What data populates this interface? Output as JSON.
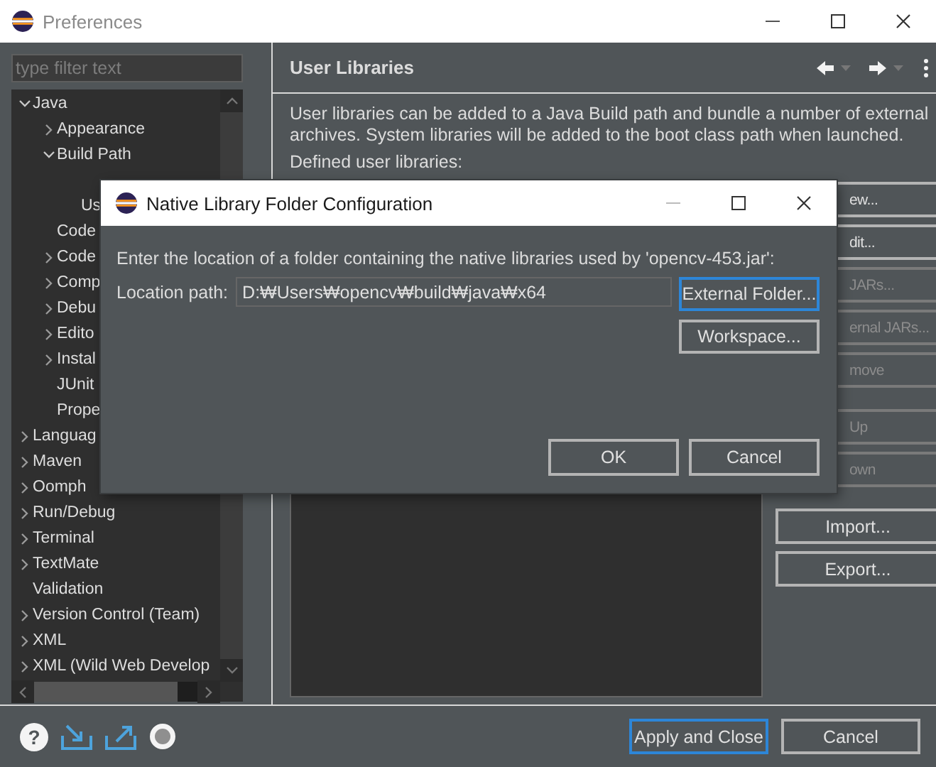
{
  "window": {
    "title": "Preferences"
  },
  "filter": {
    "placeholder": "type filter text"
  },
  "tree": [
    {
      "label": "Java",
      "expandable": true,
      "expanded": true,
      "children": [
        {
          "label": "Appearance",
          "expandable": true,
          "expanded": false
        },
        {
          "label": "Build Path",
          "expandable": true,
          "expanded": true,
          "children": [
            {
              "kind": "covered"
            },
            {
              "kind": "item",
              "label": "Us",
              "expandable": false,
              "expanded": false
            }
          ]
        },
        {
          "label": "Code",
          "expandable": false,
          "expanded": false
        },
        {
          "label": "Code",
          "expandable": true,
          "expanded": false
        },
        {
          "label": "Comp",
          "expandable": true,
          "expanded": false
        },
        {
          "label": "Debu",
          "expandable": true,
          "expanded": false
        },
        {
          "label": "Edito",
          "expandable": true,
          "expanded": false
        },
        {
          "label": "Instal",
          "expandable": true,
          "expanded": false
        },
        {
          "label": "JUnit",
          "expandable": false,
          "expanded": false
        },
        {
          "label": "Prope",
          "expandable": false,
          "expanded": false
        }
      ]
    },
    {
      "label": "Languag",
      "expandable": true,
      "expanded": false
    },
    {
      "label": "Maven",
      "expandable": true,
      "expanded": false
    },
    {
      "label": "Oomph",
      "expandable": true,
      "expanded": false
    },
    {
      "label": "Run/Debug",
      "expandable": true,
      "expanded": false
    },
    {
      "label": "Terminal",
      "expandable": true,
      "expanded": false
    },
    {
      "label": "TextMate",
      "expandable": true,
      "expanded": false
    },
    {
      "label": "Validation",
      "expandable": false,
      "expanded": false
    },
    {
      "label": "Version Control (Team)",
      "expandable": true,
      "expanded": false
    },
    {
      "label": "XML",
      "expandable": true,
      "expanded": false
    },
    {
      "label": "XML (Wild Web Develop",
      "expandable": true,
      "expanded": false
    }
  ],
  "page": {
    "title": "User Libraries",
    "description": "User libraries can be added to a Java Build path and bundle a number of external archives. System libraries will be added to the boot class path when launched.",
    "list_label": "Defined user libraries:",
    "buttons": [
      {
        "label": "ew...",
        "disabled": false,
        "kind": "top"
      },
      {
        "label": "dit...",
        "disabled": false,
        "kind": "top"
      },
      {
        "label": "JARs...",
        "disabled": true,
        "kind": "top"
      },
      {
        "label": "ernal JARs...",
        "disabled": true,
        "kind": "top"
      },
      {
        "label": "move",
        "disabled": true,
        "kind": "top"
      },
      {
        "label": "Up",
        "disabled": true,
        "kind": "group"
      },
      {
        "label": "own",
        "disabled": true,
        "kind": "top"
      },
      {
        "label": "Import...",
        "disabled": false,
        "kind": "group"
      },
      {
        "label": "Export...",
        "disabled": false,
        "kind": "top"
      }
    ]
  },
  "help_icon": {
    "glyph": "?"
  },
  "footer_buttons": [
    {
      "label": "Apply and Close",
      "default": true
    },
    {
      "label": "Cancel",
      "default": false
    }
  ],
  "dialog": {
    "title": "Native Library Folder Configuration",
    "message": "Enter the location of a folder containing the native libraries used by 'opencv-453.jar':",
    "path_label": "Location path:",
    "path_value": "D:₩Users₩opencv₩build₩java₩x64",
    "side_buttons": [
      {
        "label": "External Folder...",
        "default": true
      },
      {
        "label": "Workspace...",
        "default": false
      }
    ],
    "buttons": [
      {
        "label": "OK",
        "default": false
      },
      {
        "label": "Cancel",
        "default": false
      }
    ]
  }
}
